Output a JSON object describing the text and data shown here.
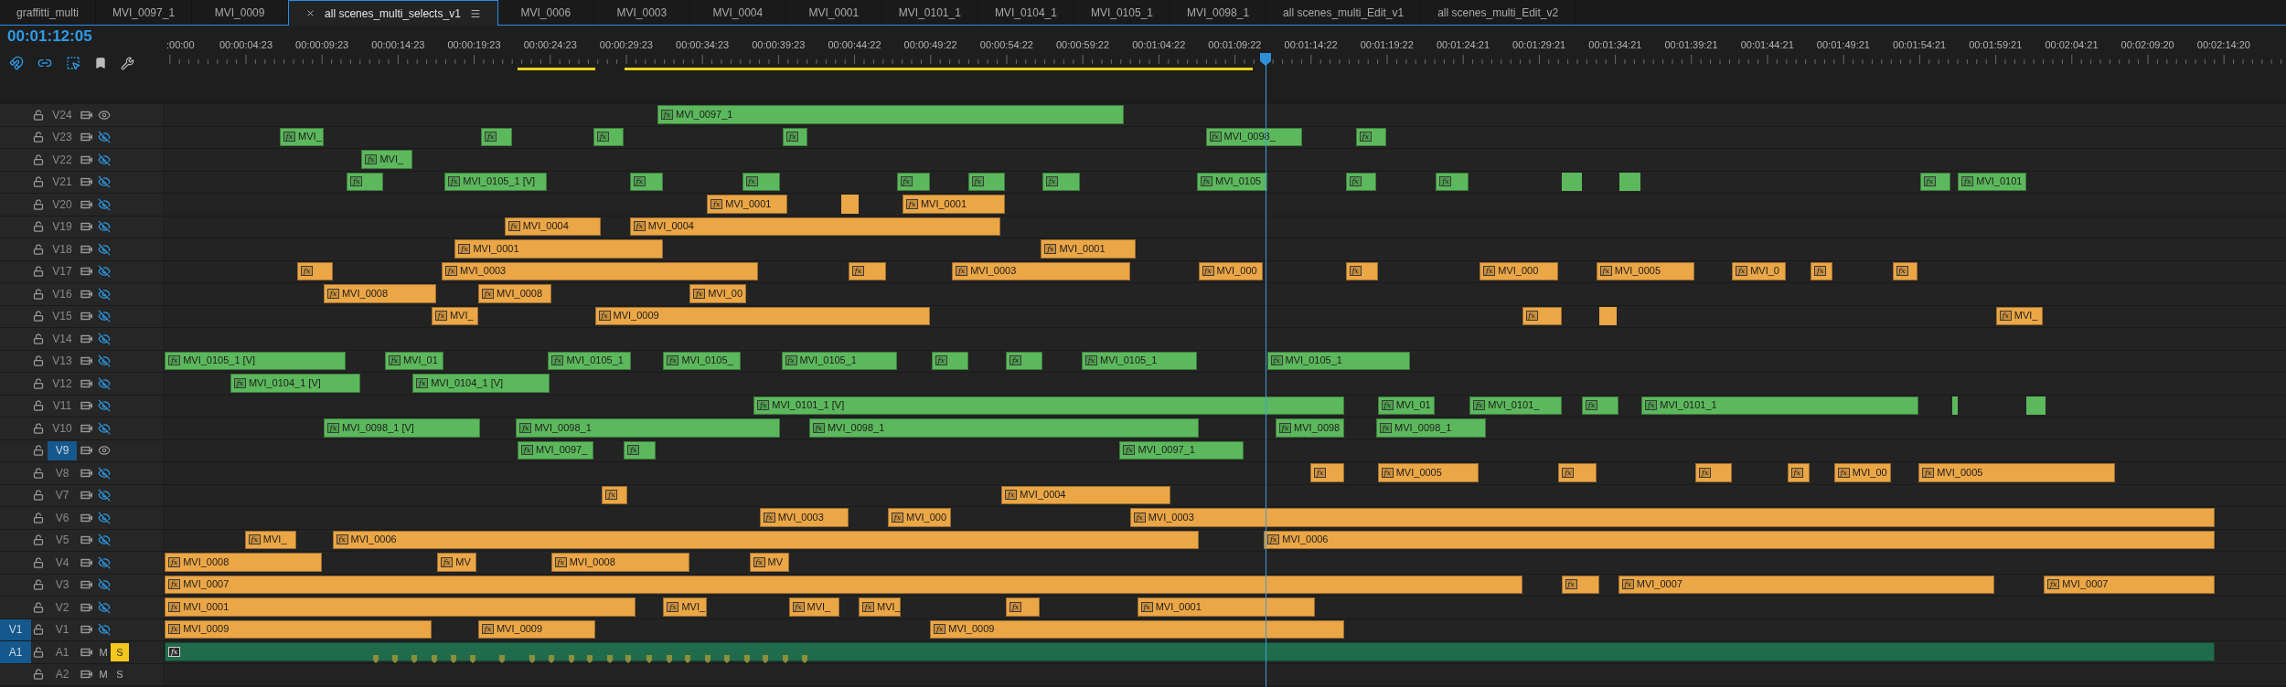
{
  "tabs": [
    {
      "label": "graffitti_multi",
      "selected": false
    },
    {
      "label": "MVI_0097_1",
      "selected": false
    },
    {
      "label": "MVI_0009",
      "selected": false
    },
    {
      "label": "all scenes_multi_selects_v1",
      "selected": true
    },
    {
      "label": "MVI_0006",
      "selected": false
    },
    {
      "label": "MVI_0003",
      "selected": false
    },
    {
      "label": "MVI_0004",
      "selected": false
    },
    {
      "label": "MVI_0001",
      "selected": false
    },
    {
      "label": "MVI_0101_1",
      "selected": false
    },
    {
      "label": "MVI_0104_1",
      "selected": false
    },
    {
      "label": "MVI_0105_1",
      "selected": false
    },
    {
      "label": "MVI_0098_1",
      "selected": false
    },
    {
      "label": "all scenes_multi_Edit_v1",
      "selected": false
    },
    {
      "label": "all scenes_multi_Edit_v2",
      "selected": false
    }
  ],
  "timecode": "00:01:12:05",
  "ruler": {
    "labels": [
      ":00:00",
      "00:00:04:23",
      "00:00:09:23",
      "00:00:14:23",
      "00:00:19:23",
      "00:00:24:23",
      "00:00:29:23",
      "00:00:34:23",
      "00:00:39:23",
      "00:00:44:22",
      "00:00:49:22",
      "00:00:54:22",
      "00:00:59:22",
      "00:01:04:22",
      "00:01:09:22",
      "00:01:14:22",
      "00:01:19:22",
      "00:01:24:21",
      "00:01:29:21",
      "00:01:34:21",
      "00:01:39:21",
      "00:01:44:21",
      "00:01:49:21",
      "00:01:54:21",
      "00:01:59:21",
      "00:02:04:21",
      "00:02:09:20",
      "00:02:14:20"
    ]
  },
  "tracks": [
    {
      "kind": "video",
      "name": "V24",
      "visible": true,
      "targeted": false,
      "color": "#5cb85c",
      "clips": [
        {
          "fx": "fx",
          "label": "MVI_0097_1"
        }
      ]
    },
    {
      "kind": "video",
      "name": "V23",
      "visible": false,
      "targeted": false,
      "color": "#5cb85c",
      "clips": [
        {
          "fx": "fx",
          "label": "MVI_"
        },
        {
          "fx": "fx"
        },
        {
          "fx": "fx"
        },
        {
          "fx": "fx"
        },
        {
          "fx": "fx",
          "label": "MVI_0098_"
        },
        {
          "fx": "fx"
        }
      ]
    },
    {
      "kind": "video",
      "name": "V22",
      "visible": false,
      "targeted": false,
      "color": "#5cb85c",
      "clips": [
        {
          "fx": "fx",
          "label": "MVI_"
        }
      ]
    },
    {
      "kind": "video",
      "name": "V21",
      "visible": false,
      "targeted": false,
      "color": "#5cb85c",
      "clips": [
        {
          "fx": "fx"
        },
        {
          "fx": "fx",
          "label": "MVI_0105_1 [V]"
        },
        {
          "fx": "fx"
        },
        {
          "fx": "fx"
        },
        {
          "fx": "fx"
        },
        {
          "fx": "fx"
        },
        {
          "fx": "fx"
        },
        {
          "fx": "fx",
          "label": "MVI_0105"
        },
        {
          "fx": "fx"
        },
        {
          "fx": "fx"
        },
        {
          "kind": "plain"
        },
        {
          "kind": "plain"
        },
        {
          "fx": "fx"
        },
        {
          "fx": "fx",
          "label": "MVI_0101"
        }
      ]
    },
    {
      "kind": "video",
      "name": "V20",
      "visible": false,
      "targeted": false,
      "color": "#eba646",
      "clips": [
        {
          "fx": "fx",
          "label": "MVI_0001"
        },
        {
          "kind": "plain"
        },
        {
          "fx": "fx",
          "label": "MVI_0001"
        }
      ]
    },
    {
      "kind": "video",
      "name": "V19",
      "visible": false,
      "targeted": false,
      "color": "#eba646",
      "clips": [
        {
          "fx": "fx",
          "label": "MVI_0004"
        },
        {
          "fx": "fx",
          "label": "MVI_0004"
        }
      ]
    },
    {
      "kind": "video",
      "name": "V18",
      "visible": false,
      "targeted": false,
      "color": "#eba646",
      "clips": [
        {
          "fx": "fx",
          "label": "MVI_0001"
        },
        {
          "fx": "fx",
          "label": "MVI_0001"
        }
      ]
    },
    {
      "kind": "video",
      "name": "V17",
      "visible": false,
      "targeted": false,
      "color": "#eba646",
      "clips": [
        {
          "fx": "fx"
        },
        {
          "fx": "fx",
          "label": "MVI_0003"
        },
        {
          "fx": "fx"
        },
        {
          "fx": "fx",
          "label": "MVI_0003"
        },
        {
          "fx": "fx",
          "label": "MVI_000"
        },
        {
          "fx": "fx"
        },
        {
          "fx": "fx",
          "label": "MVI_000"
        },
        {
          "fx": "fx",
          "label": "MVI_0005"
        },
        {
          "fx": "fx",
          "label": "MVI_0"
        },
        {
          "fx": "fx"
        },
        {
          "fx": "fx"
        }
      ]
    },
    {
      "kind": "video",
      "name": "V16",
      "visible": false,
      "targeted": false,
      "color": "#eba646",
      "clips": [
        {
          "fx": "fx",
          "label": "MVI_0008"
        },
        {
          "fx": "fx",
          "label": "MVI_0008"
        },
        {
          "fx": "fx",
          "label": "MVI_00"
        }
      ]
    },
    {
      "kind": "video",
      "name": "V15",
      "visible": false,
      "targeted": false,
      "color": "#eba646",
      "clips": [
        {
          "fx": "fx",
          "label": "MVI_"
        },
        {
          "fx": "fx",
          "label": "MVI_0009"
        },
        {
          "fx": "fx"
        },
        {
          "kind": "plain"
        },
        {
          "fx": "fx",
          "label": "MVI_"
        }
      ]
    },
    {
      "kind": "video",
      "name": "V14",
      "visible": false,
      "targeted": false
    },
    {
      "kind": "video",
      "name": "V13",
      "visible": false,
      "targeted": false,
      "color": "#5cb85c",
      "clips": [
        {
          "fx": "fx",
          "label": "MVI_0105_1 [V]"
        },
        {
          "fx": "fx",
          "label": "MVI_01"
        },
        {
          "fx": "fx",
          "label": "MVI_0105_1"
        },
        {
          "fx": "fx",
          "label": "MVI_0105_"
        },
        {
          "fx": "fx",
          "label": "MVI_0105_1"
        },
        {
          "fx": "fx"
        },
        {
          "fx": "fx"
        },
        {
          "fx": "fx",
          "label": "MVI_0105_1"
        },
        {
          "fx": "fx",
          "label": "MVI_0105_1"
        }
      ]
    },
    {
      "kind": "video",
      "name": "V12",
      "visible": false,
      "targeted": false,
      "color": "#5cb85c",
      "clips": [
        {
          "fx": "fx",
          "label": "MVI_0104_1 [V]"
        },
        {
          "fx": "fx",
          "label": "MVI_0104_1 [V]"
        }
      ]
    },
    {
      "kind": "video",
      "name": "V11",
      "visible": false,
      "targeted": false,
      "color": "#5cb85c",
      "clips": [
        {
          "fx": "fx",
          "label": "MVI_0101_1 [V]"
        },
        {
          "fx": "fx",
          "label": "MVI_01"
        },
        {
          "fx": "fx",
          "label": "MVI_0101_"
        },
        {
          "fx": "fx"
        },
        {
          "fx": "fx",
          "label": "MVI_0101_1"
        },
        {
          "kind": "plain"
        },
        {
          "kind": "plain"
        }
      ]
    },
    {
      "kind": "video",
      "name": "V10",
      "visible": false,
      "targeted": false,
      "color": "#5cb85c",
      "clips": [
        {
          "fx": "fx",
          "label": "MVI_0098_1 [V]"
        },
        {
          "fx": "fx",
          "label": "MVI_0098_1"
        },
        {
          "fx": "fx",
          "label": "MVI_0098_1"
        },
        {
          "fx": "fx",
          "label": "MVI_0098"
        },
        {
          "fx": "fx",
          "label": "MVI_0098_1"
        }
      ]
    },
    {
      "kind": "video",
      "name": "V9",
      "visible": true,
      "targeted": true,
      "color": "#5cb85c",
      "clips": [
        {
          "fx": "fx",
          "label": "MVI_0097_"
        },
        {
          "fx": "fx"
        },
        {
          "fx": "fx",
          "label": "MVI_0097_1"
        }
      ]
    },
    {
      "kind": "video",
      "name": "V8",
      "visible": false,
      "targeted": false,
      "color": "#eba646",
      "clips": [
        {
          "fx": "fx"
        },
        {
          "fx": "fx",
          "label": "MVI_0005"
        },
        {
          "fx": "fx"
        },
        {
          "fx": "fx"
        },
        {
          "fx": "fx"
        },
        {
          "fx": "fx",
          "label": "MVI_00"
        },
        {
          "fx": "fx",
          "label": "MVI_0005"
        }
      ]
    },
    {
      "kind": "video",
      "name": "V7",
      "visible": false,
      "targeted": false,
      "color": "#eba646",
      "clips": [
        {
          "fx": "fx"
        },
        {
          "fx": "fx",
          "label": "MVI_0004"
        }
      ]
    },
    {
      "kind": "video",
      "name": "V6",
      "visible": false,
      "targeted": false,
      "color": "#eba646",
      "clips": [
        {
          "fx": "fx",
          "label": "MVI_0003"
        },
        {
          "fx": "fx",
          "label": "MVI_000"
        },
        {
          "fx": "fx",
          "label": "MVI_0003"
        }
      ]
    },
    {
      "kind": "video",
      "name": "V5",
      "visible": false,
      "targeted": false,
      "color": "#eba646",
      "clips": [
        {
          "fx": "fx",
          "label": "MVI_"
        },
        {
          "fx": "fx",
          "label": "MVI_0006"
        },
        {
          "fx": "fx",
          "label": "MVI_0006"
        }
      ]
    },
    {
      "kind": "video",
      "name": "V4",
      "visible": false,
      "targeted": false,
      "color": "#eba646",
      "clips": [
        {
          "fx": "fx",
          "label": "MVI_0008"
        },
        {
          "fx": "fx",
          "label": "MV"
        },
        {
          "fx": "fx",
          "label": "MVI_0008"
        },
        {
          "fx": "fx",
          "label": "MV"
        }
      ]
    },
    {
      "kind": "video",
      "name": "V3",
      "visible": false,
      "targeted": false,
      "color": "#eba646",
      "clips": [
        {
          "fx": "fx",
          "label": "MVI_0007"
        },
        {
          "fx": "fx"
        },
        {
          "fx": "fx",
          "label": "MVI_0007"
        },
        {
          "fx": "fx",
          "label": "MVI_0007"
        }
      ]
    },
    {
      "kind": "video",
      "name": "V2",
      "visible": false,
      "targeted": false,
      "color": "#eba646",
      "clips": [
        {
          "fx": "fx",
          "label": "MVI_0001"
        },
        {
          "fx": "fx",
          "label": "MVI_"
        },
        {
          "fx": "fx",
          "label": "MVI_"
        },
        {
          "fx": "fx",
          "label": "MVI_"
        },
        {
          "fx": "fx"
        },
        {
          "fx": "fx",
          "label": "MVI_0001"
        }
      ]
    },
    {
      "kind": "video",
      "name": "V1",
      "source": "V1",
      "visible": false,
      "targeted": false,
      "color": "#eba646",
      "clips": [
        {
          "fx": "fx",
          "label": "MVI_0009"
        },
        {
          "fx": "fx",
          "label": "MVI_0009"
        },
        {
          "fx": "fx",
          "label": "MVI_0009"
        }
      ]
    },
    {
      "kind": "audio",
      "name": "A1",
      "source": "A1",
      "targeted": false,
      "mute": "M",
      "solo": "S",
      "solo_on": true,
      "color": "#1f6b4b",
      "clips": [
        {
          "fx": "fx"
        }
      ]
    },
    {
      "kind": "audio",
      "name": "A2",
      "targeted": false,
      "mute": "M",
      "solo": "S",
      "solo_on": false
    }
  ]
}
